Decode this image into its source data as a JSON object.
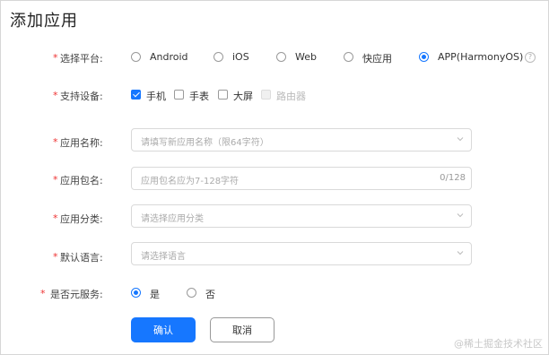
{
  "page": {
    "title": "添加应用",
    "watermark": "@稀土掘金技术社区"
  },
  "form": {
    "required_mark": "*",
    "platform": {
      "label": "选择平台:",
      "options": [
        "Android",
        "iOS",
        "Web",
        "快应用",
        "APP(HarmonyOS)"
      ],
      "selected": "APP(HarmonyOS)",
      "help_glyph": "?"
    },
    "devices": {
      "label": "支持设备:",
      "options": [
        "手机",
        "手表",
        "大屏",
        "路由器"
      ],
      "checked": [
        "手机"
      ],
      "disabled": [
        "路由器"
      ]
    },
    "app_name": {
      "label": "应用名称:",
      "placeholder": "请填写新应用名称（限64字符）"
    },
    "package_name": {
      "label": "应用包名:",
      "placeholder": "应用包名应为7-128字符",
      "counter": "0/128"
    },
    "category": {
      "label": "应用分类:",
      "placeholder": "请选择应用分类"
    },
    "language": {
      "label": "默认语言:",
      "placeholder": "请选择语言"
    },
    "metaservice": {
      "label": "是否元服务:",
      "options": [
        "是",
        "否"
      ],
      "selected": "是"
    }
  },
  "buttons": {
    "confirm": "确认",
    "cancel": "取消"
  },
  "colors": {
    "accent": "#1677ff",
    "required": "#e33333"
  }
}
